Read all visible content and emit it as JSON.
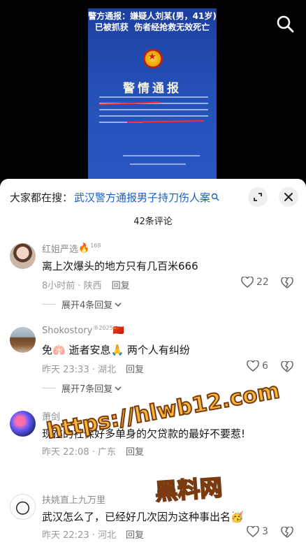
{
  "video": {
    "headline_line1_a": "警方通报：",
    "headline_line1_b": "嫌疑人刘某(男，41岁)",
    "headline_line2_a": "已被抓获",
    "headline_line2_b": "伤者经抢救无效死亡",
    "notice_title": "警情通报",
    "search_icon": "search-icon"
  },
  "search_bar": {
    "prefix": "大家都在搜：",
    "term": "武汉警方通报男子持刀伤人案"
  },
  "comment_count": "42条评论",
  "comments": [
    {
      "user": "红姐严选",
      "badge": "🔥",
      "badge_sup": "168",
      "text": "离上次爆头的地方只有几百米666",
      "time_loc": "8小时前 · 陕西",
      "reply": "回复",
      "likes": "22",
      "expand": "展开4条回复"
    },
    {
      "user": "Shokostory",
      "badge": "🇨🇳",
      "badge_sup": "®2025",
      "text": "免🫁 逝者安息🙏 两个人有纠纷",
      "time_loc": "昨天 23:33 · 湖北",
      "reply": "回复",
      "likes": "6",
      "expand": "展开7条回复"
    },
    {
      "user": "萧剑",
      "text": "现在的社保好多单身的欠贷款的最好不要惹!",
      "time_loc": "昨天 22:08 · 广东",
      "reply": "回复"
    },
    {
      "user": "扶姚直上九万里",
      "text": "武汉怎么了，已经好几次因为这种事出名🥳",
      "time_loc": "昨天 22:23 · 河北",
      "reply": "回复",
      "likes": "3"
    }
  ],
  "watermark": {
    "url": "https://hlwb12.com",
    "brand": "黑料网"
  }
}
